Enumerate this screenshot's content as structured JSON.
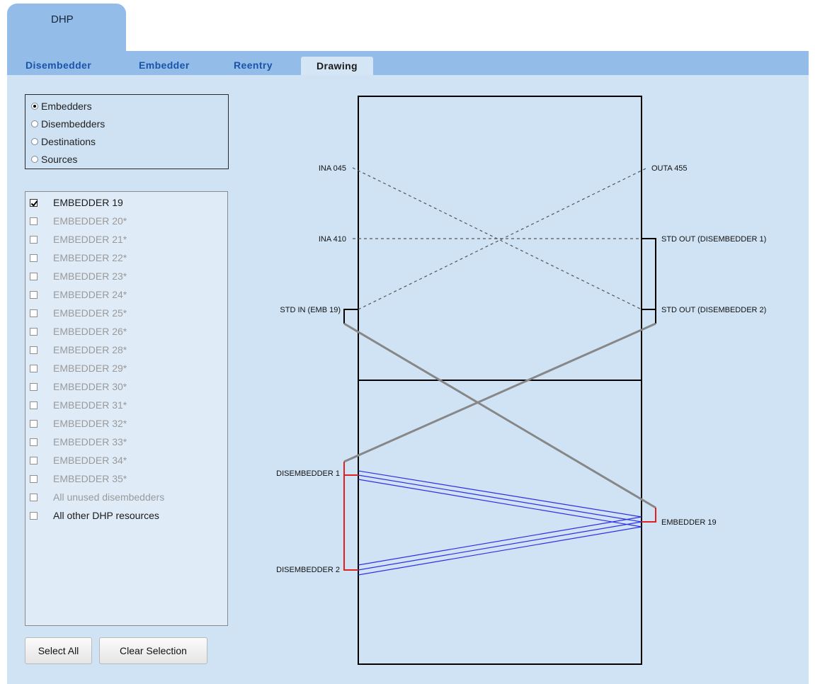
{
  "top_tab": {
    "label": "DHP"
  },
  "tabs": [
    {
      "label": "Disembedder"
    },
    {
      "label": "Embedder"
    },
    {
      "label": "Reentry"
    },
    {
      "label": "Drawing"
    }
  ],
  "radio_options": [
    {
      "label": "Embedders",
      "selected": true
    },
    {
      "label": "Disembedders",
      "selected": false
    },
    {
      "label": "Destinations",
      "selected": false
    },
    {
      "label": "Sources",
      "selected": false
    }
  ],
  "list_items": [
    {
      "label": "EMBEDDER 19",
      "checked": true,
      "enabled": true
    },
    {
      "label": "EMBEDDER 20*",
      "checked": false,
      "enabled": false
    },
    {
      "label": "EMBEDDER 21*",
      "checked": false,
      "enabled": false
    },
    {
      "label": "EMBEDDER 22*",
      "checked": false,
      "enabled": false
    },
    {
      "label": "EMBEDDER 23*",
      "checked": false,
      "enabled": false
    },
    {
      "label": "EMBEDDER 24*",
      "checked": false,
      "enabled": false
    },
    {
      "label": "EMBEDDER 25*",
      "checked": false,
      "enabled": false
    },
    {
      "label": "EMBEDDER 26*",
      "checked": false,
      "enabled": false
    },
    {
      "label": "EMBEDDER 28*",
      "checked": false,
      "enabled": false
    },
    {
      "label": "EMBEDDER 29*",
      "checked": false,
      "enabled": false
    },
    {
      "label": "EMBEDDER 30*",
      "checked": false,
      "enabled": false
    },
    {
      "label": "EMBEDDER 31*",
      "checked": false,
      "enabled": false
    },
    {
      "label": "EMBEDDER 32*",
      "checked": false,
      "enabled": false
    },
    {
      "label": "EMBEDDER 33*",
      "checked": false,
      "enabled": false
    },
    {
      "label": "EMBEDDER 34*",
      "checked": false,
      "enabled": false
    },
    {
      "label": "EMBEDDER 35*",
      "checked": false,
      "enabled": false
    },
    {
      "label": "All unused disembedders",
      "checked": false,
      "enabled": false
    },
    {
      "label": "All other DHP resources",
      "checked": false,
      "enabled": true
    }
  ],
  "buttons": {
    "select_all": "Select All",
    "clear_selection": "Clear Selection"
  },
  "diagram": {
    "labels": {
      "ina045": "INA 045",
      "outa455": "OUTA 455",
      "ina410": "INA 410",
      "std_out_d1": "STD OUT (DISEMBEDDER 1)",
      "std_in": "STD IN (EMB 19)",
      "std_out_d2": "STD OUT (DISEMBEDDER 2)",
      "disembedder1": "DISEMBEDDER 1",
      "disembedder2": "DISEMBEDDER 2",
      "embedder19": "EMBEDDER 19"
    },
    "colors": {
      "audio_link": "#2e2ee6",
      "video_link": "#878787",
      "selection": "#e02020",
      "frame": "#000000"
    }
  }
}
